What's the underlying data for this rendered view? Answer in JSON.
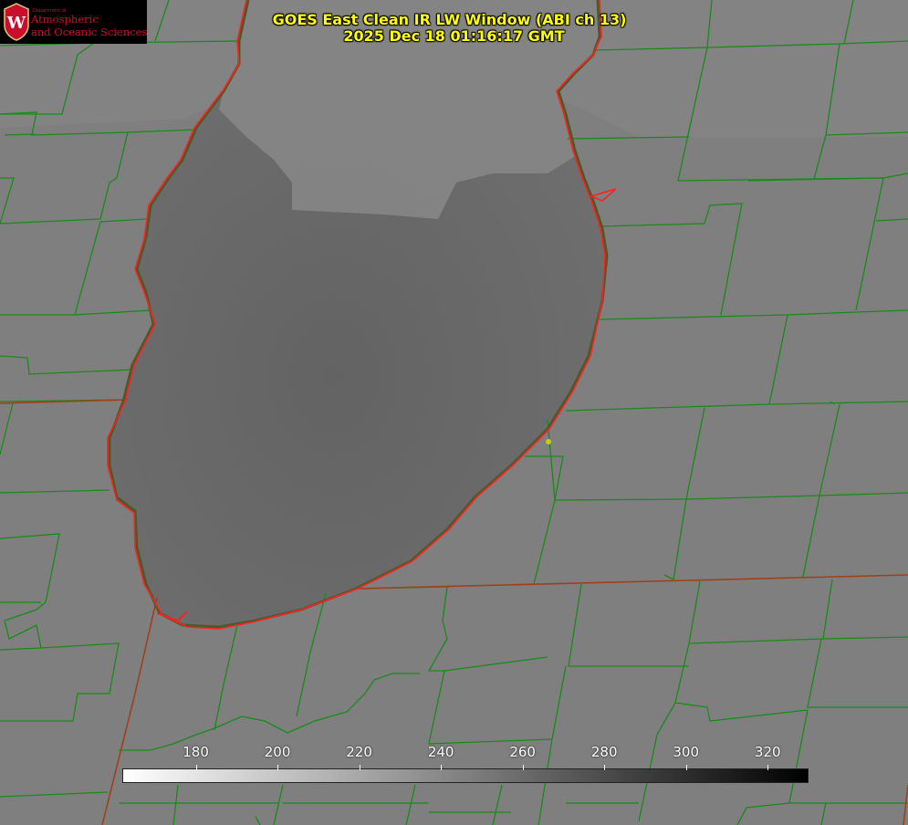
{
  "title": {
    "line1": "GOES East Clean IR LW Window (ABI ch 13)",
    "line2": "2025 Dec 18 01:16:17 GMT"
  },
  "logo": {
    "small": "Department of",
    "line1": "Atmospheric",
    "line2": "and Oceanic Sciences",
    "seal_letter": "W"
  },
  "colorbar": {
    "ticks": [
      "180",
      "200",
      "220",
      "240",
      "260",
      "280",
      "300",
      "320"
    ],
    "range": [
      162,
      330
    ],
    "gradient": "white-to-black"
  },
  "colors": {
    "coastline": "#ff2020",
    "county_lines": "#1a8a1a",
    "state_lines": "#a0401a",
    "title_text": "#ffff00",
    "marker": "#cccc00"
  },
  "features": {
    "lake": "lake-michigan",
    "marker": "yellow-station-dot"
  }
}
